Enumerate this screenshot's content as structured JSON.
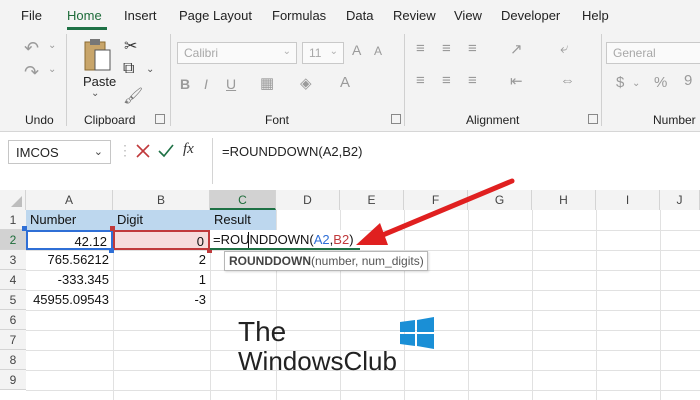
{
  "menu": {
    "items": [
      "File",
      "Home",
      "Insert",
      "Page Layout",
      "Formulas",
      "Data",
      "Review",
      "View",
      "Developer",
      "Help"
    ],
    "active": "Home"
  },
  "ribbon": {
    "undo_label": "Undo",
    "clipboard_label": "Clipboard",
    "paste_label": "Paste",
    "font_label": "Font",
    "font_name": "Calibri",
    "font_size": "11",
    "alignment_label": "Alignment",
    "number_label": "Number",
    "number_format": "General"
  },
  "formula_bar": {
    "name_box": "IMCOS",
    "formula": "=ROUNDDOWN(A2,B2)"
  },
  "sheet": {
    "columns": [
      "A",
      "B",
      "C",
      "D",
      "E",
      "F",
      "G",
      "H",
      "I",
      "J"
    ],
    "rows": [
      "1",
      "2",
      "3",
      "4",
      "5",
      "6",
      "7",
      "8",
      "9"
    ],
    "header_row": {
      "a": "Number",
      "b": "Digit",
      "c": "Result"
    },
    "data": [
      {
        "a": "42.12",
        "b": "0"
      },
      {
        "a": "765.56212",
        "b": "2"
      },
      {
        "a": "-333.345",
        "b": "1"
      },
      {
        "a": "45955.09543",
        "b": "-3"
      }
    ],
    "editing_formula": {
      "prefix": "=ROUNDDOWN(",
      "ref1": "A2",
      "comma": ",",
      "ref2": "B2",
      "suffix": ")"
    },
    "tooltip": {
      "func": "ROUNDDOWN",
      "args": "(number, num_digits)"
    }
  },
  "watermark": {
    "line1": "The",
    "line2": "WindowsClub"
  },
  "colors": {
    "accent": "#1e7145",
    "ref1": "#2f6fd6",
    "ref2": "#c0393b",
    "arrow": "#e02020"
  }
}
